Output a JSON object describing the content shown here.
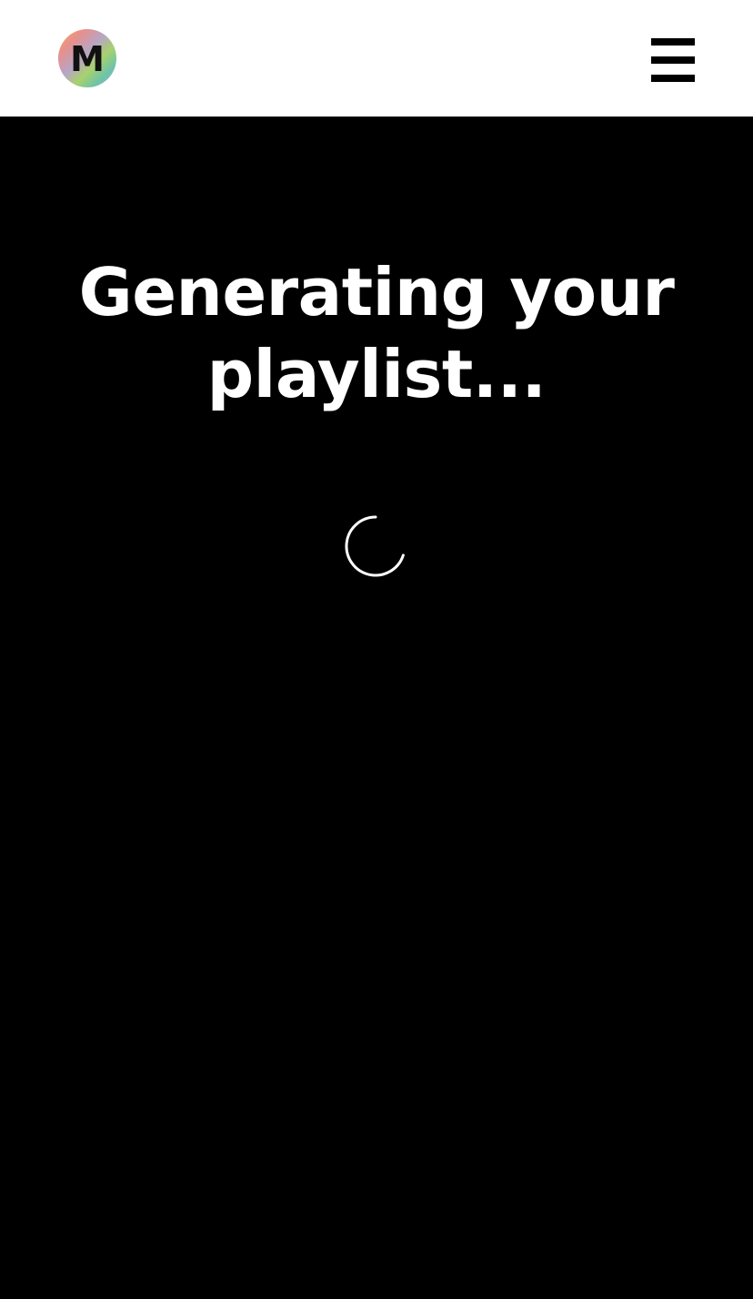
{
  "header": {
    "logo_letter": "M",
    "logo_icon": "app-logo-icon",
    "menu_icon": "hamburger-menu-icon"
  },
  "main": {
    "title": "Generating your playlist...",
    "loading_icon": "loading-spinner-icon"
  },
  "colors": {
    "header_bg": "#ffffff",
    "page_bg": "#000000",
    "text": "#ffffff"
  }
}
